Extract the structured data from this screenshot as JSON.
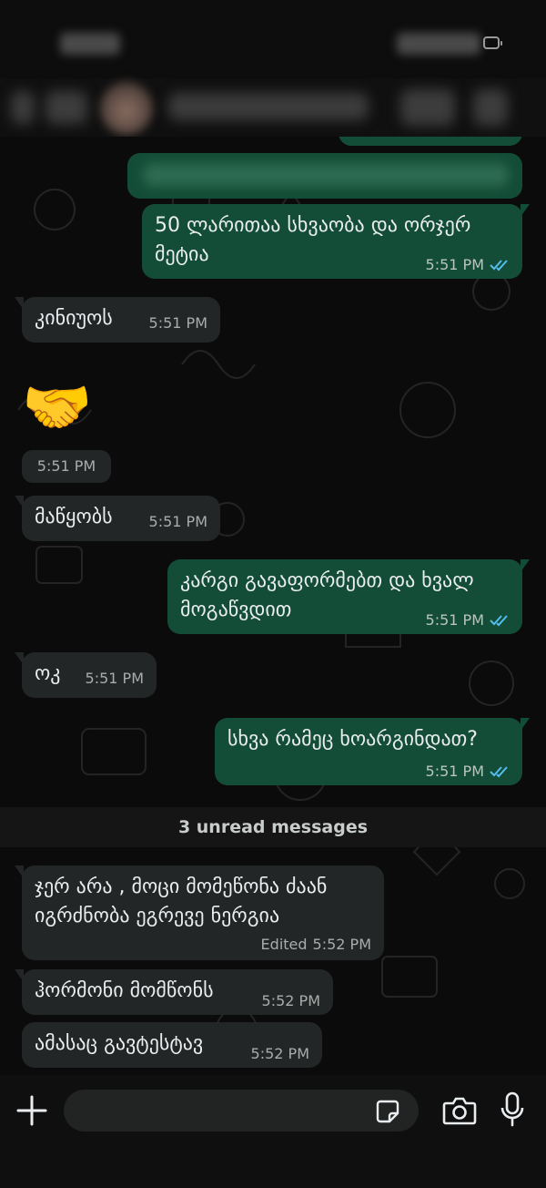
{
  "header": {
    "contact_name": "",
    "status_time": ""
  },
  "messages": [
    {
      "id": "m1",
      "direction": "out",
      "text": "50 ლარითაა სხვაობა და ორჯერ\nმეტია",
      "time": "5:51 PM",
      "read": true
    },
    {
      "id": "m2",
      "direction": "in",
      "text": "კინიუოს",
      "time": "5:51 PM"
    },
    {
      "id": "m3",
      "direction": "in",
      "emoji": "🤝",
      "time": "5:51 PM"
    },
    {
      "id": "m4",
      "direction": "in",
      "text": "მაწყობს",
      "time": "5:51 PM"
    },
    {
      "id": "m5",
      "direction": "out",
      "text": "კარგი გავაფორმებთ და ხვალ\nმოგაწვდით",
      "time": "5:51 PM",
      "read": true
    },
    {
      "id": "m6",
      "direction": "in",
      "text": "ოკ",
      "time": "5:51 PM"
    },
    {
      "id": "m7",
      "direction": "out",
      "text": "სხვა რამეც ხოარგინდათ?",
      "time": "5:51 PM",
      "read": true
    },
    {
      "id": "m8",
      "direction": "in",
      "text": "ჯერ არა , მოცი მომეწონა ძაან\nიგრძნობა ეგრევე ნერგია",
      "edited_label": "Edited",
      "time": "5:52 PM"
    },
    {
      "id": "m9",
      "direction": "in",
      "text": "ჰორმონი მომწონს",
      "time": "5:52 PM"
    },
    {
      "id": "m10",
      "direction": "in",
      "text": "ამასაც გავტესტავ",
      "time": "5:52 PM"
    }
  ],
  "unread_banner": "3 unread messages",
  "input": {
    "value": "",
    "placeholder": ""
  },
  "icons": {
    "attach": "plus-icon",
    "sticker": "sticker-icon",
    "camera": "camera-icon",
    "mic": "mic-icon",
    "read_receipt": "double-check-icon"
  },
  "colors": {
    "outgoing_bubble": "#144d37",
    "incoming_bubble": "#232626",
    "read_check": "#53bdeb",
    "background": "#0b0b0b"
  }
}
